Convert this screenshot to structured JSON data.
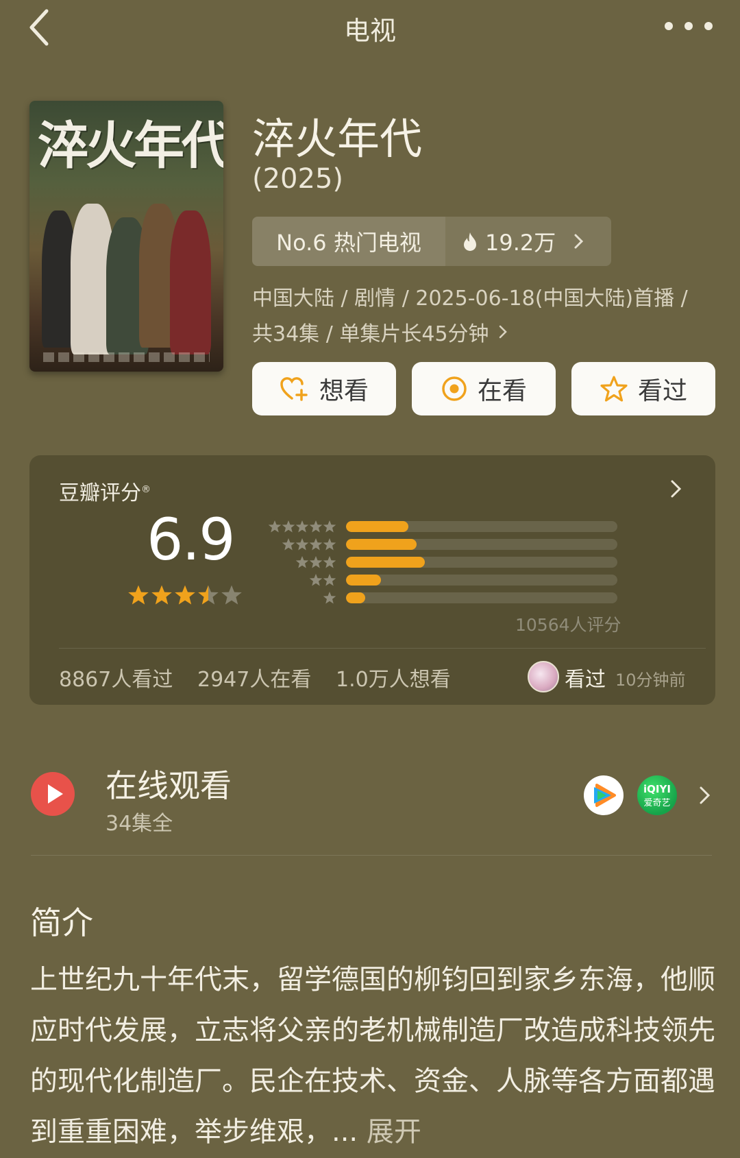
{
  "nav": {
    "title": "电视"
  },
  "poster": {
    "title": "淬火年代"
  },
  "show": {
    "title": "淬火年代",
    "year": "(2025)",
    "rank_label": "No.6 热门电视",
    "heat": "19.2万",
    "meta_line1": "中国大陆 / 剧情 / 2025-06-18(中国大陆)首播 /",
    "meta_line2": "共34集 / 单集片长45分钟"
  },
  "actions": [
    {
      "label": "想看",
      "icon": "heart-plus-icon"
    },
    {
      "label": "在看",
      "icon": "target-circle-icon"
    },
    {
      "label": "看过",
      "icon": "star-outline-icon"
    }
  ],
  "rating": {
    "label": "豆瓣评分",
    "score": "6.9",
    "stars": 3.5,
    "raters": "10564人评分",
    "distribution": [
      {
        "stars": 5,
        "fraction": 0.23
      },
      {
        "stars": 4,
        "fraction": 0.26
      },
      {
        "stars": 3,
        "fraction": 0.29
      },
      {
        "stars": 2,
        "fraction": 0.13
      },
      {
        "stars": 1,
        "fraction": 0.07
      }
    ],
    "watched": "8867人看过",
    "watching": "2947人在看",
    "wish": "1.0万人想看",
    "friend_status": "看过",
    "friend_time": "10分钟前"
  },
  "online": {
    "title": "在线观看",
    "subtitle": "34集全",
    "platforms": [
      "tencent-video-icon",
      "iqiyi-icon"
    ],
    "iqiyi_text": "iQIYI",
    "iqiyi_cn": "爱奇艺"
  },
  "intro": {
    "title": "简介",
    "text": "上世纪九十年代末，留学德国的柳钧回到家乡东海，他顺应时代发展，立志将父亲的老机械制造厂改造成科技领先的现代化制造厂。民企在技术、资金、人脉等各方面都遇到重重困难，举步维艰，...",
    "expand": "展开"
  },
  "colors": {
    "background": "#6b6342",
    "accent": "#f0a21c",
    "play": "#e8524a"
  }
}
